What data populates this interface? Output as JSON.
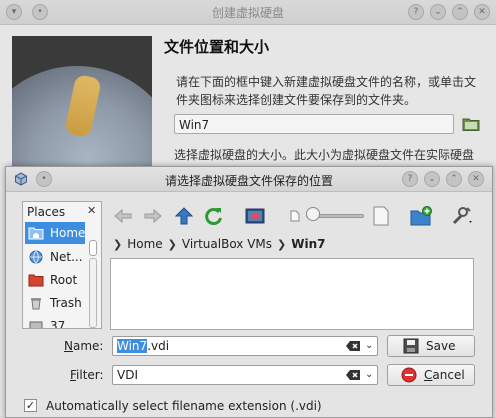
{
  "wizard": {
    "title": "创建虚拟硬盘",
    "heading": "文件位置和大小",
    "description": "请在下面的框中键入新建虚拟硬盘文件的名称，或单击文件夹图标来选择创建文件要保存到的文件夹。",
    "file_value": "Win7",
    "size_description": "选择虚拟硬盘的大小。此大小为虚拟硬盘文件在实际硬盘中使用的极限大小。"
  },
  "dialog": {
    "title": "请选择虚拟硬盘文件保存的位置",
    "places": {
      "title": "Places",
      "items": [
        {
          "label": "Home",
          "icon": "home-folder-icon",
          "selected": true
        },
        {
          "label": "Net...",
          "icon": "network-icon",
          "selected": false
        },
        {
          "label": "Root",
          "icon": "root-folder-icon",
          "selected": false
        },
        {
          "label": "Trash",
          "icon": "trash-icon",
          "selected": false
        },
        {
          "label": "37",
          "icon": "drive-icon",
          "selected": false
        }
      ]
    },
    "toolbar": [
      "back-icon",
      "forward-icon",
      "up-icon",
      "reload-icon",
      "preview-icon",
      "zoom-out-icon",
      "zoom-in-icon",
      "new-folder-icon",
      "options-icon"
    ],
    "breadcrumb": [
      "Home",
      "VirtualBox VMs",
      "Win7"
    ],
    "name_label": "Name:",
    "name_value_selected": "Win7",
    "name_value_rest": ".vdi",
    "filter_label": "Filter:",
    "filter_value": "VDI",
    "save_label": "Save",
    "cancel_label": "Cancel",
    "auto_extension_label": "Automatically select filename extension (.vdi)",
    "auto_extension_checked": true
  },
  "colors": {
    "selection": "#3d8ede",
    "window_bg": "#e4e4e4"
  }
}
